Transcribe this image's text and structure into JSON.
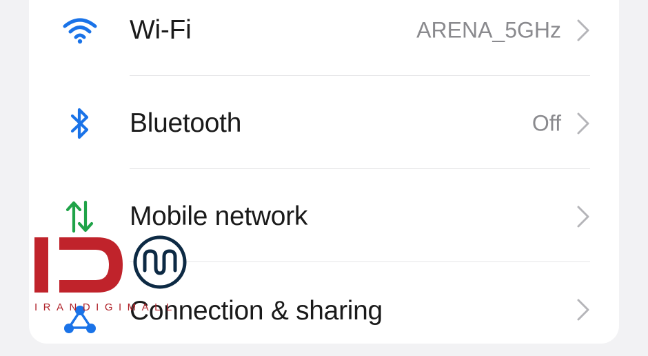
{
  "settings": {
    "rows": [
      {
        "id": "wifi",
        "label": "Wi-Fi",
        "value": "ARENA_5GHz",
        "icon": "wifi-icon",
        "icon_color": "#1a73e8"
      },
      {
        "id": "bluetooth",
        "label": "Bluetooth",
        "value": "Off",
        "icon": "bluetooth-icon",
        "icon_color": "#1a73e8"
      },
      {
        "id": "mobile-network",
        "label": "Mobile network",
        "value": "",
        "icon": "mobile-data-arrows-icon",
        "icon_color": "#1fa348"
      },
      {
        "id": "connection-sharing",
        "label": "Connection & sharing",
        "value": "",
        "icon": "share-icon",
        "icon_color": "#1a73e8"
      }
    ]
  },
  "watermark": {
    "brand_text": "IRANDIGIMALL",
    "brand_color": "#c0232b",
    "mark_color": "#0d2a44"
  }
}
